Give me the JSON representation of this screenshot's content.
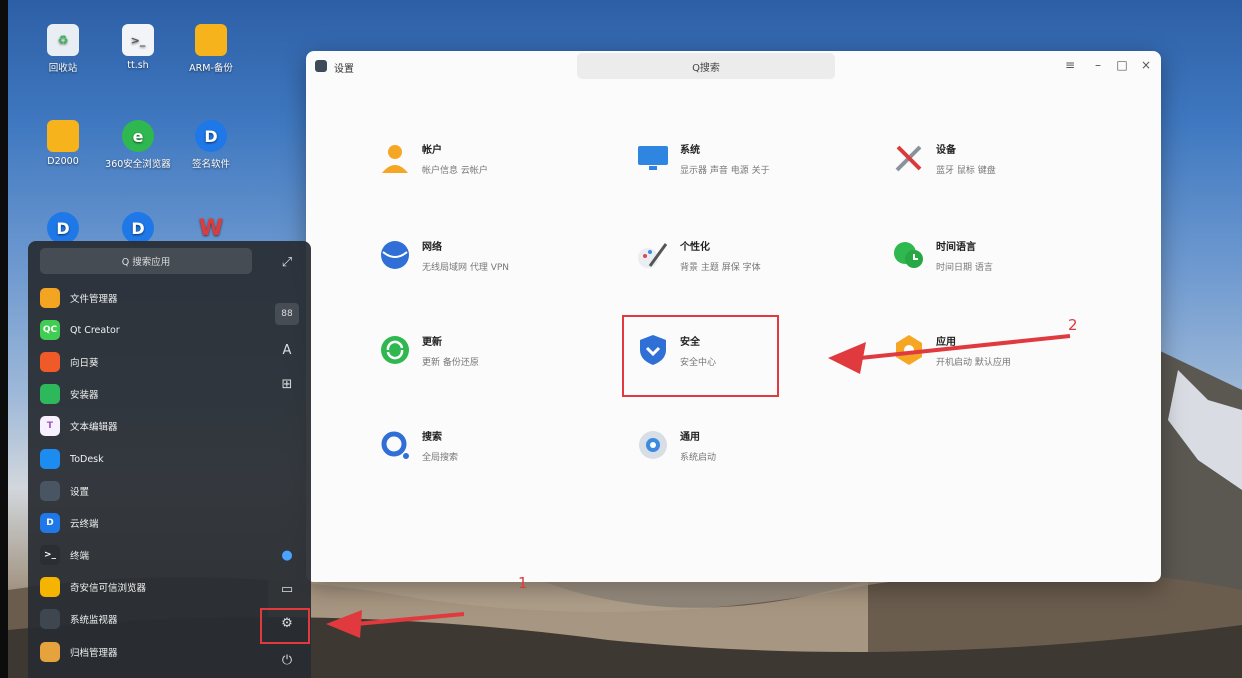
{
  "desktop": {
    "icons": [
      {
        "label": "回收站",
        "icon": "trash-icon",
        "color": "#e8eef4"
      },
      {
        "label": "tt.sh",
        "icon": "script-file-icon",
        "color": "#f2f4f7"
      },
      {
        "label": "ARM-备份",
        "icon": "folder-icon",
        "color": "#f6b31b"
      },
      {
        "label": "D2000",
        "icon": "folder-icon",
        "color": "#f6b31b"
      },
      {
        "label": "360安全浏览器",
        "icon": "browser-icon",
        "color": "#2fb84f"
      },
      {
        "label": "签名软件",
        "icon": "d-app-icon",
        "color": "#1e78e8"
      }
    ]
  },
  "settings": {
    "title": "设置",
    "search_placeholder": "Q搜索",
    "menu_glyph": "≡",
    "minimize_glyph": "–",
    "maximize_glyph": "□",
    "close_glyph": "×",
    "categories": [
      {
        "name": "帐户",
        "sub": "帐户信息 云帐户",
        "icon": "account-icon"
      },
      {
        "name": "系统",
        "sub": "显示器 声音 电源 关于",
        "icon": "monitor-icon"
      },
      {
        "name": "设备",
        "sub": "蓝牙 鼠标 键盘",
        "icon": "tools-icon"
      },
      {
        "name": "网络",
        "sub": "无线局域网 代理 VPN",
        "icon": "globe-icon"
      },
      {
        "name": "个性化",
        "sub": "背景 主题 屏保 字体",
        "icon": "brush-icon"
      },
      {
        "name": "时间语言",
        "sub": "时间日期 语言",
        "icon": "clock-chat-icon"
      },
      {
        "name": "更新",
        "sub": "更新 备份还原",
        "icon": "update-icon"
      },
      {
        "name": "安全",
        "sub": "安全中心",
        "icon": "shield-icon"
      },
      {
        "name": "应用",
        "sub": "开机启动 默认应用",
        "icon": "app-icon"
      },
      {
        "name": "搜索",
        "sub": "全局搜索",
        "icon": "search-icon"
      },
      {
        "name": "通用",
        "sub": "系统启动",
        "icon": "general-icon"
      }
    ]
  },
  "launcher": {
    "search_placeholder": "Q 搜索应用",
    "apps": [
      {
        "label": "文件管理器",
        "icon": "file-manager-icon",
        "color": "#f3a420",
        "glyph": ""
      },
      {
        "label": "Qt Creator",
        "icon": "qt-icon",
        "color": "#41cd52",
        "glyph": "QC"
      },
      {
        "label": "向日葵",
        "icon": "sunflower-icon",
        "color": "#f05a28",
        "glyph": ""
      },
      {
        "label": "安装器",
        "icon": "installer-icon",
        "color": "#2db85b",
        "glyph": ""
      },
      {
        "label": "文本编辑器",
        "icon": "text-editor-icon",
        "color": "#f6f0ff",
        "glyph": "T"
      },
      {
        "label": "ToDesk",
        "icon": "todesk-icon",
        "color": "#1d8cf0",
        "glyph": ""
      },
      {
        "label": "设置",
        "icon": "settings-icon",
        "color": "#4a5563",
        "glyph": ""
      },
      {
        "label": "云终端",
        "icon": "cloud-terminal-icon",
        "color": "#1e78e8",
        "glyph": "D"
      },
      {
        "label": "终端",
        "icon": "terminal-icon",
        "color": "#2b2f33",
        "glyph": ">_"
      },
      {
        "label": "奇安信可信浏览器",
        "icon": "qax-browser-icon",
        "color": "#f4b400",
        "glyph": ""
      },
      {
        "label": "系统监视器",
        "icon": "system-monitor-icon",
        "color": "#3e464f",
        "glyph": ""
      },
      {
        "label": "归档管理器",
        "icon": "archive-icon",
        "color": "#e6a23c",
        "glyph": ""
      }
    ],
    "side_buttons": [
      {
        "glyph": "⤢",
        "icon": "expand-icon"
      },
      {
        "glyph": "88",
        "icon": "category-view-icon"
      },
      {
        "glyph": "A",
        "icon": "name-sort-icon"
      },
      {
        "glyph": "⊞",
        "icon": "time-sort-icon"
      }
    ],
    "bottom_buttons": [
      {
        "glyph": "●",
        "icon": "globe-icon"
      },
      {
        "glyph": "▭",
        "icon": "computer-icon"
      },
      {
        "glyph": "⚙",
        "icon": "settings-gear-icon"
      },
      {
        "glyph": "⏻",
        "icon": "power-icon"
      }
    ]
  },
  "annotations": {
    "step1": "1",
    "step2": "2",
    "color": "#e0393e"
  }
}
